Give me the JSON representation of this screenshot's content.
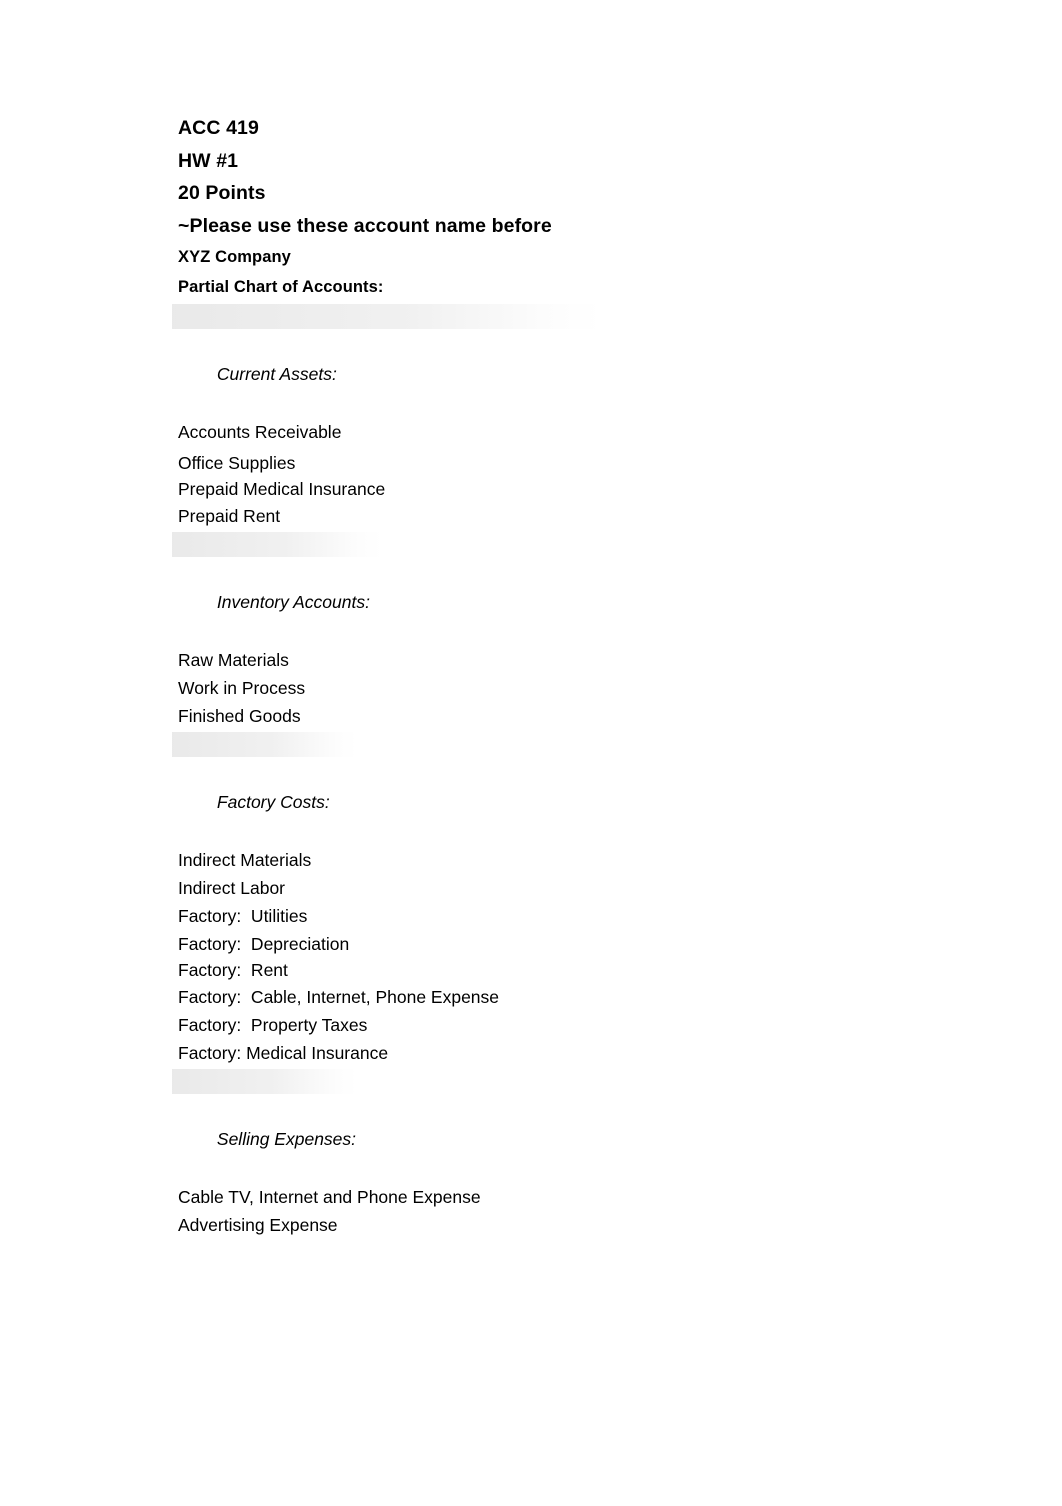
{
  "document": {
    "heading_lines": [
      "ACC 419",
      "HW #1",
      "20 Points",
      "~Please use these account name before"
    ],
    "company_line": "XYZ Company",
    "chart_title": "Partial Chart of Accounts:",
    "sections": [
      {
        "header": "Current Assets:",
        "accounts": [
          "Accounts Receivable",
          "Office Supplies",
          "Prepaid Medical Insurance",
          "Prepaid Rent"
        ]
      },
      {
        "header": "Inventory Accounts:",
        "accounts": [
          "Raw Materials",
          "Work in Process",
          "Finished Goods"
        ]
      },
      {
        "header": "Factory Costs:",
        "accounts": [
          "Indirect Materials",
          "Indirect Labor",
          "Factory:  Utilities",
          "Factory:  Depreciation",
          "Factory:  Rent",
          "Factory:  Cable, Internet, Phone Expense",
          "Factory:  Property Taxes",
          "Factory: Medical Insurance"
        ]
      },
      {
        "header": "Selling Expenses:",
        "accounts": [
          "Cable TV, Internet and Phone Expense",
          "Advertising Expense"
        ]
      }
    ]
  },
  "colors": {
    "page_background": "#ffffff",
    "text": "#000000",
    "header_highlight": "#e7e7e7"
  }
}
